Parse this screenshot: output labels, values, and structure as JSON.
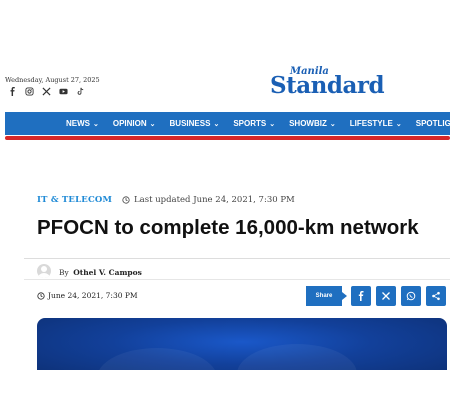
{
  "header": {
    "date": "Wednesday, August 27, 2025",
    "socials": [
      "facebook-icon",
      "instagram-icon",
      "x-icon",
      "youtube-icon",
      "tiktok-icon"
    ],
    "logo": {
      "top": "Manila",
      "main": "Standard"
    }
  },
  "nav": {
    "items": [
      {
        "label": "NEWS"
      },
      {
        "label": "OPINION"
      },
      {
        "label": "BUSINESS"
      },
      {
        "label": "SPORTS"
      },
      {
        "label": "SHOWBIZ"
      },
      {
        "label": "LIFESTYLE"
      },
      {
        "label": "SPOTLIGHT"
      }
    ]
  },
  "article": {
    "category": "IT & TELECOM",
    "last_updated": "Last updated June 24, 2021, 7:30 PM",
    "title": "PFOCN to complete 16,000-km network",
    "author_prefix": "By",
    "author": "Othel V. Campos",
    "published": "June 24, 2021, 7:30 PM"
  },
  "share": {
    "label": "Share",
    "buttons": [
      "facebook-icon",
      "x-icon",
      "whatsapp-icon",
      "share-icon"
    ]
  },
  "colors": {
    "brand": "#1f6fc0",
    "accent": "#d62828",
    "category": "#1f8ad6"
  }
}
